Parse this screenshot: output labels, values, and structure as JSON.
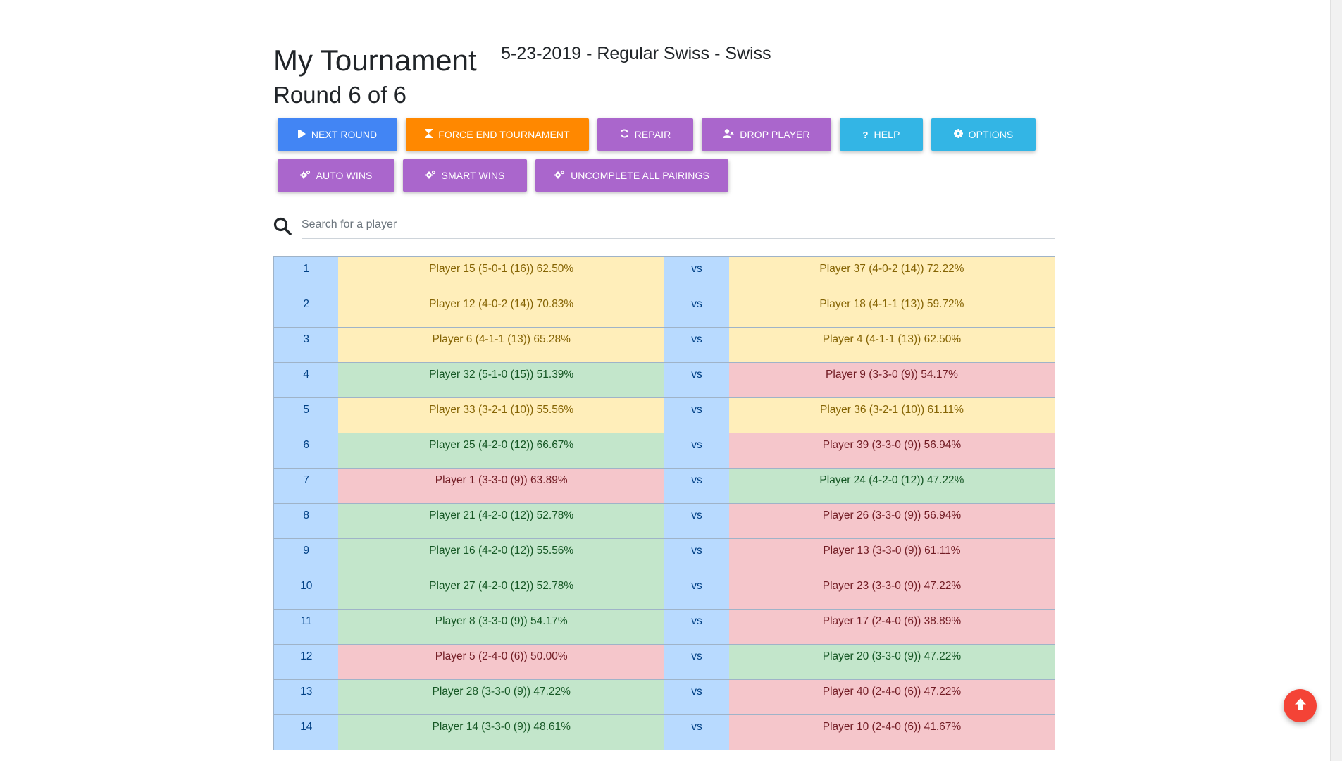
{
  "header": {
    "title": "My Tournament",
    "subtitle": "5-23-2019 - Regular Swiss - Swiss",
    "round": "Round 6 of 6"
  },
  "toolbar": {
    "row1": [
      {
        "label": "NEXT ROUND",
        "icon": "skip-icon",
        "color": "#4285f4"
      },
      {
        "label": "FORCE END TOURNAMENT",
        "icon": "hourglass-icon",
        "color": "#ff8800"
      },
      {
        "label": "REPAIR",
        "icon": "refresh-icon",
        "color": "#aa66cc"
      },
      {
        "label": "DROP PLAYER",
        "icon": "user-remove-icon",
        "color": "#aa66cc"
      },
      {
        "label": "HELP",
        "icon": "question-icon",
        "color": "#33b5e5"
      },
      {
        "label": "OPTIONS",
        "icon": "gear-icon",
        "color": "#33b5e5"
      }
    ],
    "row2": [
      {
        "label": "AUTO WINS",
        "icon": "gears-icon",
        "color": "#aa66cc"
      },
      {
        "label": "SMART WINS",
        "icon": "gears-icon",
        "color": "#aa66cc"
      },
      {
        "label": "UNCOMPLETE ALL PAIRINGS",
        "icon": "gears-icon",
        "color": "#aa66cc"
      }
    ]
  },
  "search": {
    "placeholder": "Search for a player",
    "icon": "search-icon"
  },
  "pairings": {
    "vs_label": "vs",
    "status_colors": {
      "win": "#c3e6cb",
      "loss": "#f5c6cb",
      "draw": "#ffeeba",
      "table": "#b8daff"
    },
    "rows": [
      {
        "table": "1",
        "p1": "Player 15 (5-0-1 (16)) 62.50%",
        "p1_status": "draw",
        "p2": "Player 37 (4-0-2 (14)) 72.22%",
        "p2_status": "draw"
      },
      {
        "table": "2",
        "p1": "Player 12 (4-0-2 (14)) 70.83%",
        "p1_status": "draw",
        "p2": "Player 18 (4-1-1 (13)) 59.72%",
        "p2_status": "draw"
      },
      {
        "table": "3",
        "p1": "Player 6 (4-1-1 (13)) 65.28%",
        "p1_status": "draw",
        "p2": "Player 4 (4-1-1 (13)) 62.50%",
        "p2_status": "draw"
      },
      {
        "table": "4",
        "p1": "Player 32 (5-1-0 (15)) 51.39%",
        "p1_status": "win",
        "p2": "Player 9 (3-3-0 (9)) 54.17%",
        "p2_status": "loss"
      },
      {
        "table": "5",
        "p1": "Player 33 (3-2-1 (10)) 55.56%",
        "p1_status": "draw",
        "p2": "Player 36 (3-2-1 (10)) 61.11%",
        "p2_status": "draw"
      },
      {
        "table": "6",
        "p1": "Player 25 (4-2-0 (12)) 66.67%",
        "p1_status": "win",
        "p2": "Player 39 (3-3-0 (9)) 56.94%",
        "p2_status": "loss"
      },
      {
        "table": "7",
        "p1": "Player 1 (3-3-0 (9)) 63.89%",
        "p1_status": "loss",
        "p2": "Player 24 (4-2-0 (12)) 47.22%",
        "p2_status": "win"
      },
      {
        "table": "8",
        "p1": "Player 21 (4-2-0 (12)) 52.78%",
        "p1_status": "win",
        "p2": "Player 26 (3-3-0 (9)) 56.94%",
        "p2_status": "loss"
      },
      {
        "table": "9",
        "p1": "Player 16 (4-2-0 (12)) 55.56%",
        "p1_status": "win",
        "p2": "Player 13 (3-3-0 (9)) 61.11%",
        "p2_status": "loss"
      },
      {
        "table": "10",
        "p1": "Player 27 (4-2-0 (12)) 52.78%",
        "p1_status": "win",
        "p2": "Player 23 (3-3-0 (9)) 47.22%",
        "p2_status": "loss"
      },
      {
        "table": "11",
        "p1": "Player 8 (3-3-0 (9)) 54.17%",
        "p1_status": "win",
        "p2": "Player 17 (2-4-0 (6)) 38.89%",
        "p2_status": "loss"
      },
      {
        "table": "12",
        "p1": "Player 5 (2-4-0 (6)) 50.00%",
        "p1_status": "loss",
        "p2": "Player 20 (3-3-0 (9)) 47.22%",
        "p2_status": "win"
      },
      {
        "table": "13",
        "p1": "Player 28 (3-3-0 (9)) 47.22%",
        "p1_status": "win",
        "p2": "Player 40 (2-4-0 (6)) 47.22%",
        "p2_status": "loss"
      },
      {
        "table": "14",
        "p1": "Player 14 (3-3-0 (9)) 48.61%",
        "p1_status": "win",
        "p2": "Player 10 (2-4-0 (6)) 41.67%",
        "p2_status": "loss"
      }
    ]
  },
  "fab": {
    "icon": "arrow-up-icon",
    "color": "#f44336"
  }
}
